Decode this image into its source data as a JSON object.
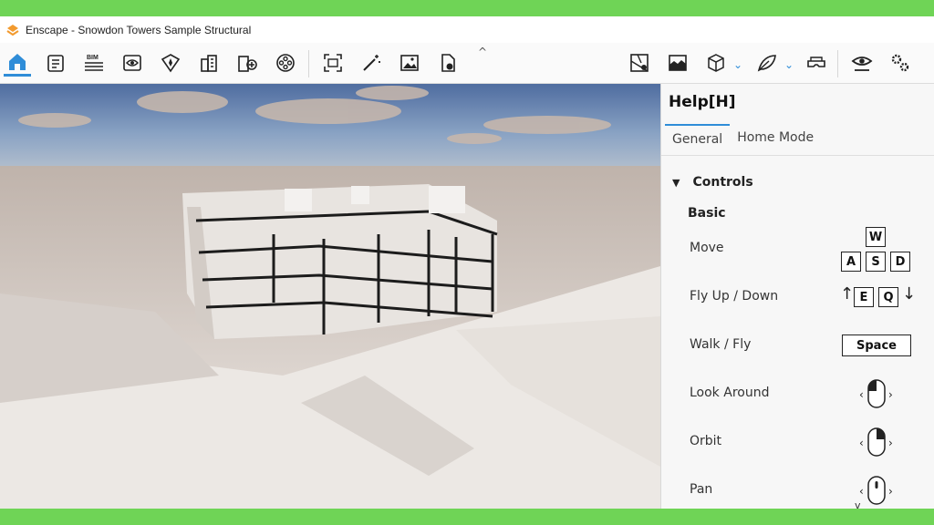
{
  "window": {
    "title": "Enscape - Snowdon Towers Sample Structural",
    "colors": {
      "frame": "#6fd456",
      "accent": "#2f8dd8",
      "logo": "#f29a2e"
    }
  },
  "toolbar": {
    "left_icons": [
      "home-icon",
      "notes-icon",
      "bim-icon",
      "view-icon",
      "site-icon",
      "buildings-icon",
      "asset-library-icon",
      "video-reel-icon"
    ],
    "middle_icons": [
      "screenshot-icon",
      "magic-wand-icon",
      "image-icon",
      "export-file-icon"
    ],
    "bim_label": "BIM",
    "right_icons": [
      "map-icon",
      "atmosphere-icon",
      "cube-icon",
      "leaf-icon",
      "vr-headset-icon",
      "eye-icon",
      "settings-icon"
    ],
    "collapse_caret": "^"
  },
  "help": {
    "title": "Help[H]",
    "tabs": [
      {
        "label": "General",
        "active": true
      },
      {
        "label": "Home Mode",
        "active": false
      }
    ],
    "section": "Controls",
    "subsection": "Basic",
    "controls": [
      {
        "label": "Move",
        "keys": [
          "W",
          "A",
          "S",
          "D"
        ]
      },
      {
        "label": "Fly Up / Down",
        "keys": [
          "E",
          "Q"
        ],
        "arrows": [
          "↑",
          "↓"
        ]
      },
      {
        "label": "Walk / Fly",
        "keys": [
          "Space"
        ]
      },
      {
        "label": "Look Around",
        "mouse": "left-button-icon"
      },
      {
        "label": "Orbit",
        "mouse": "right-button-icon"
      },
      {
        "label": "Pan",
        "mouse": "middle-button-icon"
      }
    ],
    "more_indicator": "v"
  }
}
